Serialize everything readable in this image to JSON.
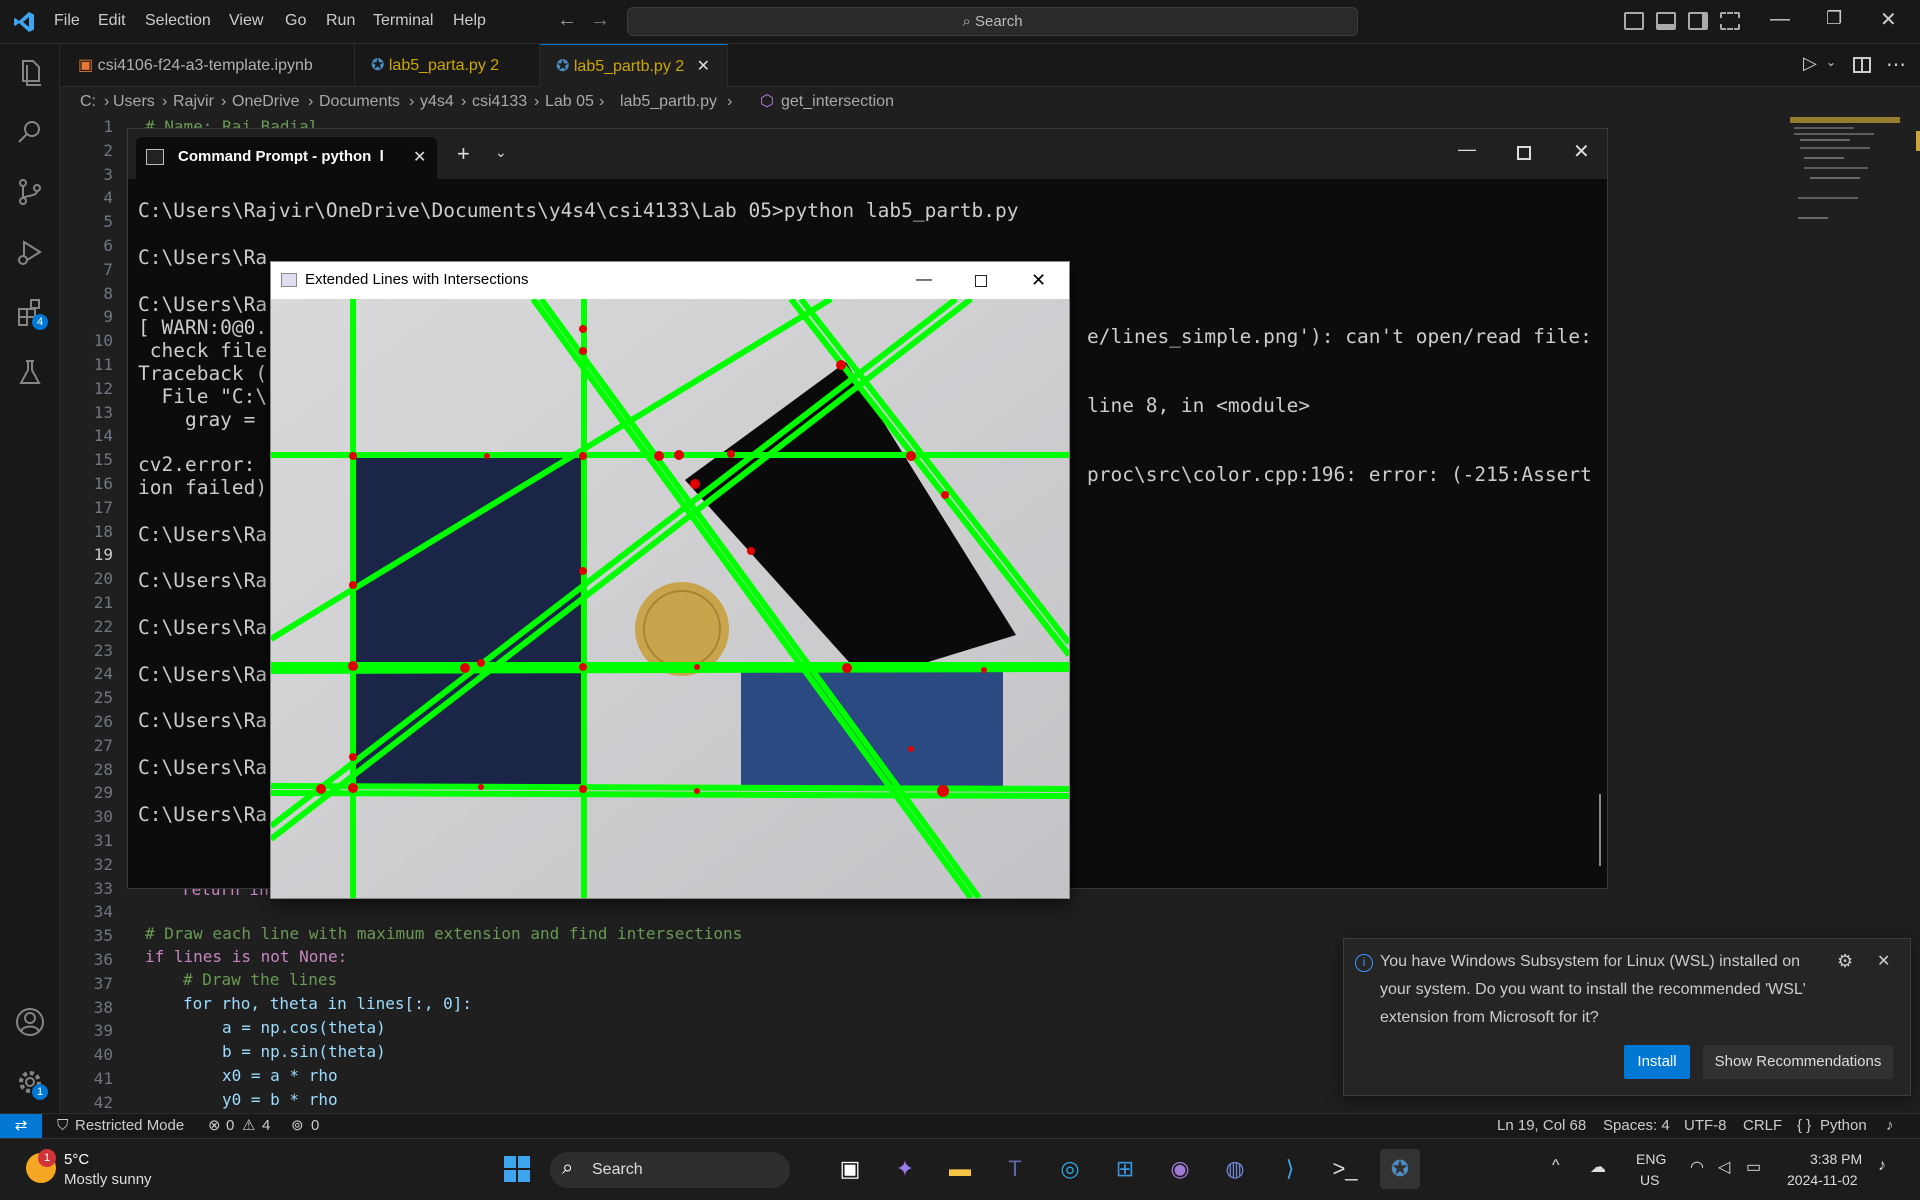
{
  "menu": [
    "File",
    "Edit",
    "Selection",
    "View",
    "Go",
    "Run",
    "Terminal",
    "Help"
  ],
  "search": {
    "label": "Search"
  },
  "activity_badges": {
    "extensions": "4",
    "settings": "1"
  },
  "tabs": [
    {
      "label": "csi4106-f24-a3-template.ipynb",
      "badge": ""
    },
    {
      "label": "lab5_parta.py",
      "badge": "2"
    },
    {
      "label": "lab5_partb.py",
      "badge": "2"
    }
  ],
  "breadcrumb": [
    "C:",
    "Users",
    "Rajvir",
    "OneDrive",
    "Documents",
    "y4s4",
    "csi4133",
    "Lab 05",
    "lab5_partb.py",
    "get_intersection"
  ],
  "editor": {
    "line_numbers": [
      "1",
      "2",
      "3",
      "4",
      "5",
      "6",
      "7",
      "8",
      "9",
      "10",
      "11",
      "12",
      "13",
      "14",
      "15",
      "16",
      "17",
      "18",
      "19",
      "20",
      "21",
      "22",
      "23",
      "24",
      "25",
      "26",
      "27",
      "28",
      "29",
      "30",
      "31",
      "32",
      "33",
      "34",
      "35",
      "36",
      "37",
      "38",
      "39",
      "40",
      "41",
      "42"
    ],
    "top_line": "# Name: Raj Badial",
    "line33": "return in",
    "line35": "# Draw each line with maximum extension and find intersections",
    "line36": "if lines is not None:",
    "line37": "# Draw the lines",
    "line38": "for rho, theta in lines[:, 0]:",
    "line39": "a = np.cos(theta)",
    "line40": "b = np.sin(theta)",
    "line41": "x0 = a * rho",
    "line42": "y0 = b * rho"
  },
  "terminal": {
    "tab_title": "Command Prompt - python  l",
    "lines": [
      "C:\\Users\\Rajvir\\OneDrive\\Documents\\y4s4\\csi4133\\Lab 05>python lab5_partb.py",
      "C:\\Users\\Ra",
      "C:\\Users\\Ra",
      "[ WARN:0@0.",
      " check file",
      "Traceback (",
      "  File \"C:\\",
      "    gray = ",
      "cv2.error: ",
      "ion failed)",
      "C:\\Users\\Ra",
      "C:\\Users\\Ra",
      "C:\\Users\\Ra",
      "C:\\Users\\Ra",
      "C:\\Users\\Ra",
      "C:\\Users\\Ra",
      "C:\\Users\\Ra"
    ],
    "right_lines": [
      "e/lines_simple.png'): can't open/read file:",
      "line 8, in <module>",
      "proc\\src\\color.cpp:196: error: (-215:Assert"
    ]
  },
  "cv_window": {
    "title": "Extended Lines with Intersections"
  },
  "toast": {
    "message_line1": "You have Windows Subsystem for Linux (WSL) installed on",
    "message_line2": "your system. Do you want to install the recommended 'WSL'",
    "message_line3": "extension from Microsoft for it?",
    "install": "Install",
    "show": "Show Recommendations"
  },
  "status": {
    "restricted": "Restricted Mode",
    "errors": "0",
    "warnings": "4",
    "ports": "0",
    "position": "Ln 19, Col 68",
    "spaces": "Spaces: 4",
    "encoding": "UTF-8",
    "eol": "CRLF",
    "language": "Python"
  },
  "taskbar": {
    "weather_temp": "5°C",
    "weather_desc": "Mostly sunny",
    "weather_badge": "1",
    "search": "Search",
    "lang1": "ENG",
    "lang2": "US",
    "time": "3:38 PM",
    "date": "2024-11-02"
  },
  "colors": {
    "accent": "#0078d4",
    "line_green": "#00ff00",
    "point_red": "#e00000",
    "tab_badge": "#cca700"
  }
}
